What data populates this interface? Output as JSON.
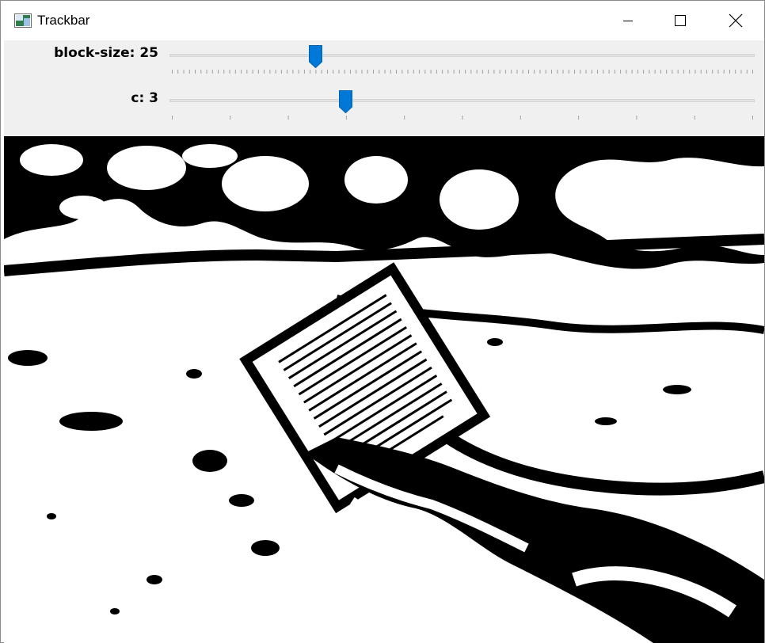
{
  "window": {
    "title": "Trackbar",
    "icon": "window-app-icon",
    "buttons": [
      "minimize-icon",
      "maximize-icon",
      "close-icon"
    ]
  },
  "trackbars": [
    {
      "label": "block-size: 25",
      "name": "block-size",
      "value": 25,
      "max": 101
    },
    {
      "label": "c: 3",
      "name": "c",
      "value": 3,
      "max": 10
    }
  ],
  "colors": {
    "thumb": "#0078d7",
    "panel": "#f0f0f0",
    "image_fg": "#000000",
    "image_bg": "#ffffff"
  }
}
